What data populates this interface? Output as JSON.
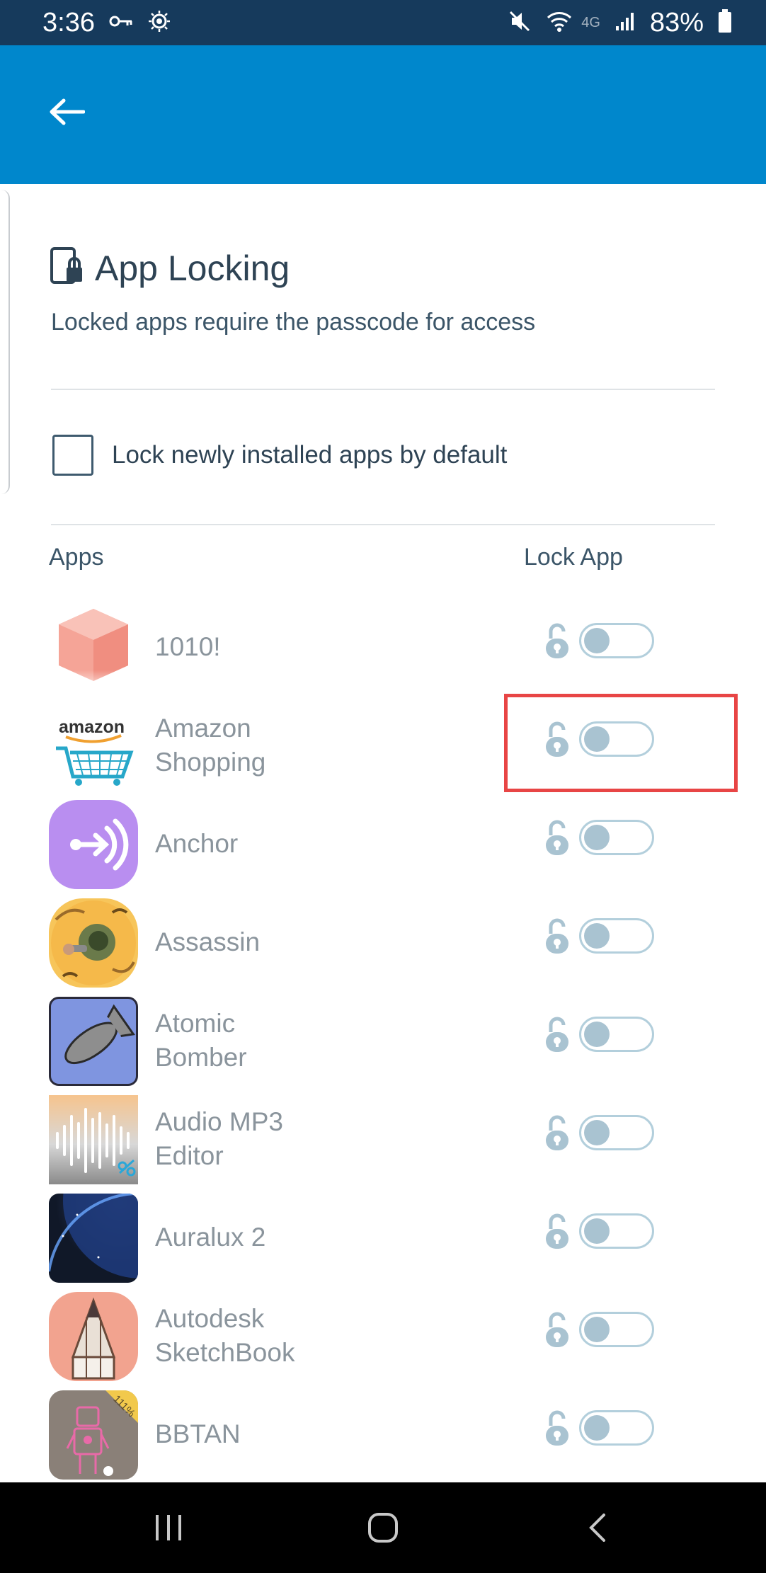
{
  "status_bar": {
    "time": "3:36",
    "network": "4G",
    "battery": "83%",
    "icons": [
      "key-icon",
      "eye-icon",
      "mute-icon",
      "wifi-icon",
      "signal-icon",
      "battery-icon"
    ]
  },
  "header": {
    "back_icon": "arrow-left-icon",
    "color": "#0087cc"
  },
  "page": {
    "title": "App Locking",
    "title_icon": "phone-lock-icon",
    "subtitle": "Locked apps require the passcode for access"
  },
  "settings": {
    "lock_new_apps_label": "Lock newly installed apps by default",
    "lock_new_apps_checked": false
  },
  "columns": {
    "apps": "Apps",
    "lock_app": "Lock App"
  },
  "apps": [
    {
      "name": "1010!",
      "locked": false
    },
    {
      "name": "Amazon\nShopping",
      "icon_text": "amazon",
      "locked": false,
      "highlighted": true
    },
    {
      "name": "Anchor",
      "locked": false
    },
    {
      "name": "Assassin",
      "locked": false
    },
    {
      "name": "Atomic\nBomber",
      "locked": false
    },
    {
      "name": "Audio MP3\nEditor",
      "locked": false
    },
    {
      "name": "Auralux 2",
      "locked": false
    },
    {
      "name": "Autodesk\nSketchBook",
      "locked": false
    },
    {
      "name": "BBTAN",
      "icon_badge": "111%",
      "locked": false
    }
  ],
  "colors": {
    "highlight": "#e84545",
    "toggle_track": "#b3cfdc",
    "toggle_knob": "#a9c3d1"
  }
}
